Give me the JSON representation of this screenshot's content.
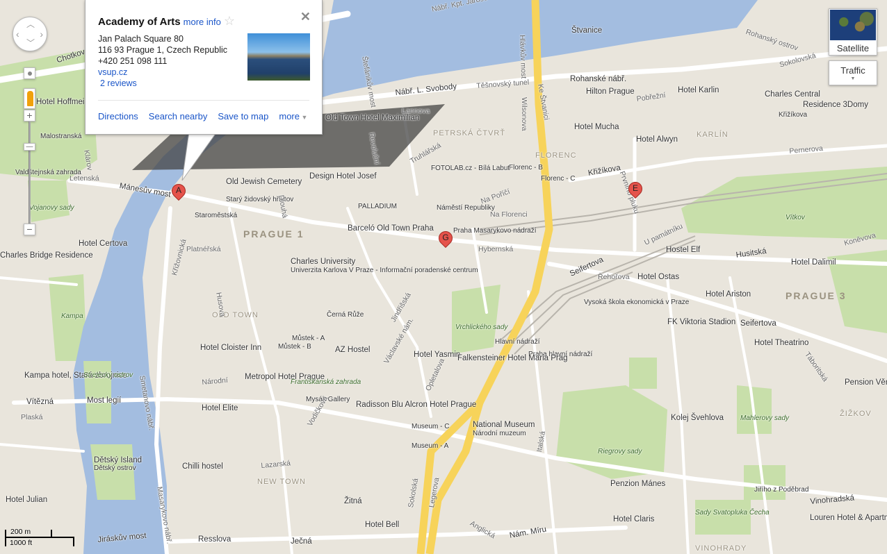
{
  "info_window": {
    "title": "Academy of Arts",
    "more_info": "more info",
    "address_line1": "Jan Palach Square 80",
    "address_line2": "116 93 Prague 1, Czech Republic",
    "phone": "+420 251 098 111",
    "website": "vsup.cz",
    "reviews": "2 reviews",
    "actions": [
      "Directions",
      "Search nearby",
      "Save to map",
      "more"
    ]
  },
  "map_type": {
    "satellite": "Satellite",
    "traffic": "Traffic"
  },
  "scale": {
    "metric": "200 m",
    "imperial": "1000 ft"
  },
  "markers": [
    "A",
    "G",
    "E"
  ],
  "colors": {
    "land": "#e9e5dc",
    "water": "#a3bde0",
    "park": "#c8dfaa",
    "highway": "#f7d35a",
    "marker": "#e5534b"
  },
  "labels": [
    "Nábř. Kpt. Jaroše",
    "Štvanice",
    "Rohanský ostrov",
    "Hlávkův most",
    "Sokolovská",
    "Rohanské nábř.",
    "Hotel Karlin",
    "Charles Central",
    "Residence 3Domy",
    "Hilton Prague",
    "Těšnovský tunel",
    "Nábř. L. Svobody",
    "Štefánikův most",
    "Lannova",
    "Pobřežní",
    "Křižíkova",
    "Hotel Mucha",
    "Hotel Alwyn",
    "KARLÍN",
    "PETRSKÁ ČTVRŤ",
    "Wilsonova",
    "Ke Štvanici",
    "FLORENC",
    "Florenc - B",
    "Florenc - C",
    "Křižíkova",
    "Pernerova",
    "Prvního pluku",
    "FOTOLAB.cz - Bílá Labuť",
    "Truhlářská",
    "Old Town Hotel Maximilian",
    "Design Hotel Josef",
    "Old Jewish Cemetery",
    "Starý židovský hřbitov",
    "Mánesův most",
    "Letenská",
    "Klárov",
    "Malostranská",
    "Hotel Hoffmeister",
    "Chotkova",
    "Valdštejnská zahrada",
    "Vojanovy sady",
    "PALLADIUM",
    "Náměstí Republiky",
    "Na Florenci",
    "PRAGUE 1",
    "Staroměstská",
    "Barceló Old Town Praha",
    "Praha Masarykovo nádraží",
    "Hybernská",
    "Hotel Certova",
    "Charles Bridge Residence",
    "Platnéřská",
    "Křižovnická",
    "Charles University",
    "Univerzita Karlova V Praze - Informační poradenské centrum",
    "Vítkov",
    "U památníku",
    "Hostel Elf",
    "Husitská",
    "Hotel Dalimil",
    "Koněvova",
    "Seifertova",
    "Hotel Ostas",
    "Řehořova",
    "Hotel Ariston",
    "PRAGUE 3",
    "Vysoká škola ekonomická v Praze",
    "FK Viktoria Stadion",
    "Seifertova",
    "Kampa",
    "OLD TOWN",
    "Černá Růže",
    "Můstek - A",
    "Můstek - B",
    "Vrchlického sady",
    "Hlavní nádraží",
    "Praha hlavní nádraží",
    "AZ Hostel",
    "Hotel Cloister Inn",
    "Hotel Yasmin",
    "Falkensteiner Hotel Maria Prag",
    "Hotel Theatrino",
    "Táboritská",
    "Kampa hotel, Stará zbrojnice",
    "Strelecky ostrov",
    "Metropol Hotel Prague",
    "Františkánská zahrada",
    "Pension Věra",
    "Vítězná",
    "Most legií",
    "Mysák Gallery",
    "Radisson Blu Alcron Hotel Prague",
    "Hotel Elite",
    "ŽIŽKOV",
    "Kolej Švehlova",
    "Mahlerovy sady",
    "Plaská",
    "Museum - C",
    "National Museum",
    "Národní muzeum",
    "Museum - A",
    "Riegrovy sady",
    "Dětský Island",
    "Dětský ostrov",
    "Chilli hostel",
    "NEW TOWN",
    "Penzion Mánes",
    "Hotel Julian",
    "Žitná",
    "Jiřího z Poděbrad",
    "Vinohradská",
    "Hotel Claris",
    "Sady Svatopluka Čecha",
    "Louren Hotel & Apartments",
    "Hotel Bell",
    "Resslova",
    "Ječná",
    "Jiráskův most",
    "Nám. Míru",
    "VINOHRADY",
    "Anglická",
    "Masarykovo nábř.",
    "Smetanovo nábř.",
    "Sokolská",
    "Legerova",
    "Italská",
    "Opletalova",
    "Husova",
    "Dlouhá",
    "Revoluční",
    "Na Poříčí",
    "Jindřišská",
    "Vodičkova",
    "Národní",
    "Lazarská",
    "Václavské nám."
  ]
}
